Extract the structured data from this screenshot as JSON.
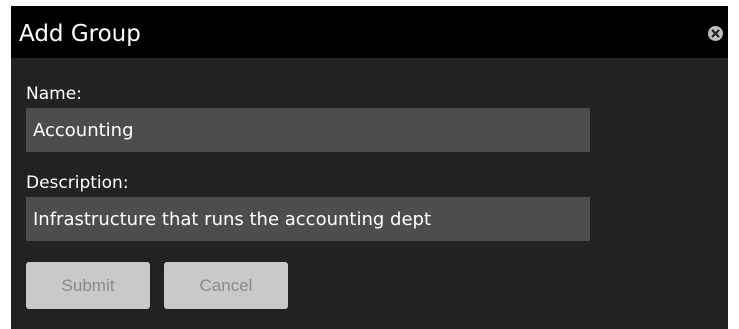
{
  "dialog": {
    "title": "Add Group",
    "close_icon": "close-icon",
    "fields": {
      "name": {
        "label": "Name:",
        "value": "Accounting"
      },
      "description": {
        "label": "Description:",
        "value": "Infrastructure that runs the accounting dept"
      }
    },
    "buttons": {
      "submit_label": "Submit",
      "cancel_label": "Cancel"
    }
  },
  "colors": {
    "titlebar_bg": "#000000",
    "dialog_bg": "#222222",
    "input_bg": "#4d4d4d",
    "button_bg": "#c9c9c9",
    "button_text": "#8a8a8a"
  }
}
